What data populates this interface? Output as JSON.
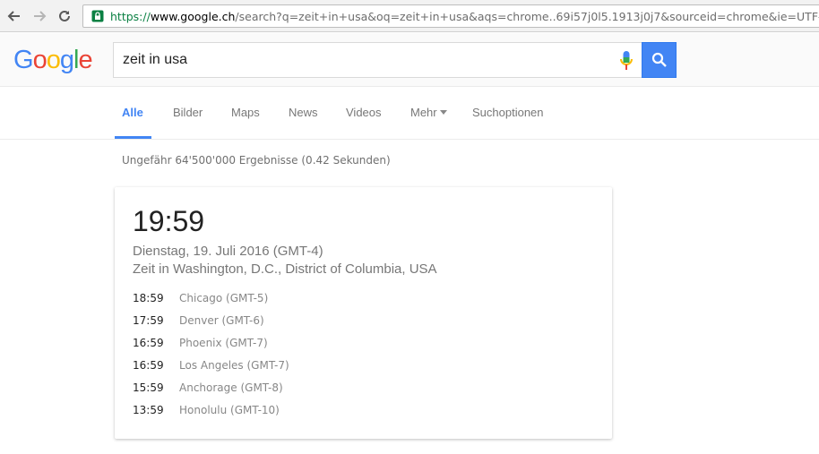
{
  "browser": {
    "url_scheme": "https://",
    "url_host": "www.google.ch",
    "url_rest": "/search?q=zeit+in+usa&oq=zeit+in+usa&aqs=chrome..69i57j0l5.1913j0j7&sourceid=chrome&ie=UTF-"
  },
  "logo": {
    "letters": [
      "G",
      "o",
      "o",
      "g",
      "l",
      "e"
    ],
    "colors": [
      "#4285f4",
      "#ea4335",
      "#fbbc05",
      "#4285f4",
      "#34a853",
      "#ea4335"
    ]
  },
  "search": {
    "query": "zeit in usa"
  },
  "tabs": {
    "all": "Alle",
    "images": "Bilder",
    "maps": "Maps",
    "news": "News",
    "videos": "Videos",
    "more": "Mehr",
    "tools": "Suchoptionen"
  },
  "result_stats": "Ungefähr 64'500'000 Ergebnisse (0.42 Sekunden)",
  "time_card": {
    "time": "19:59",
    "date": "Dienstag, 19. Juli 2016 (GMT-4)",
    "place": "Zeit in Washington, D.C., District of Columbia, USA",
    "zones": [
      {
        "time": "18:59",
        "name": "Chicago (GMT-5)"
      },
      {
        "time": "17:59",
        "name": "Denver (GMT-6)"
      },
      {
        "time": "16:59",
        "name": "Phoenix (GMT-7)"
      },
      {
        "time": "16:59",
        "name": "Los Angeles (GMT-7)"
      },
      {
        "time": "15:59",
        "name": "Anchorage (GMT-8)"
      },
      {
        "time": "13:59",
        "name": "Honolulu (GMT-10)"
      }
    ]
  },
  "colors": {
    "accent": "#4285f4",
    "secure_green": "#0b8043"
  }
}
